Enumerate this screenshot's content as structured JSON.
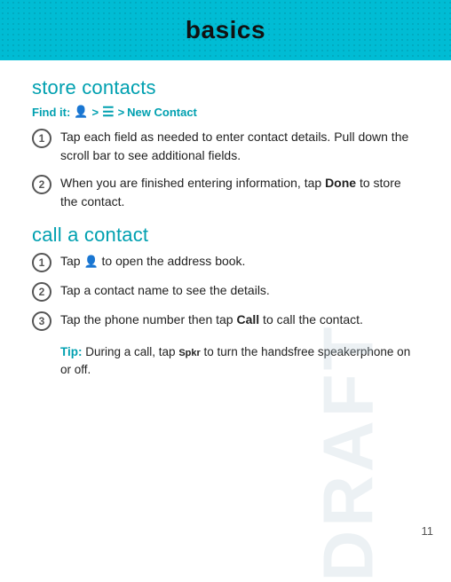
{
  "header": {
    "title": "basics"
  },
  "page": {
    "number": "11"
  },
  "watermark": "DRAFT",
  "store_contacts": {
    "section_title": "store contacts",
    "find_it_label": "Find it:",
    "find_it_arrow1": ">",
    "find_it_arrow2": ">",
    "find_it_new_contact": "New Contact",
    "steps": [
      {
        "num": "1",
        "text": "Tap each field as needed to enter contact details. Pull down the scroll bar to see additional fields."
      },
      {
        "num": "2",
        "text_before": "When you are finished entering information, tap ",
        "bold": "Done",
        "text_after": " to store the contact."
      }
    ]
  },
  "call_a_contact": {
    "section_title": "call a contact",
    "steps": [
      {
        "num": "1",
        "text_before": "Tap ",
        "text_after": " to open the address book."
      },
      {
        "num": "2",
        "text": "Tap a contact name to see the details."
      },
      {
        "num": "3",
        "text_before": "Tap the phone number then tap ",
        "bold": "Call",
        "text_after": " to call the contact."
      }
    ],
    "tip_label": "Tip:",
    "tip_text_before": " During a call, tap ",
    "tip_spkr": "Spkr",
    "tip_text_after": " to turn the handsfree speakerphone on or off."
  }
}
